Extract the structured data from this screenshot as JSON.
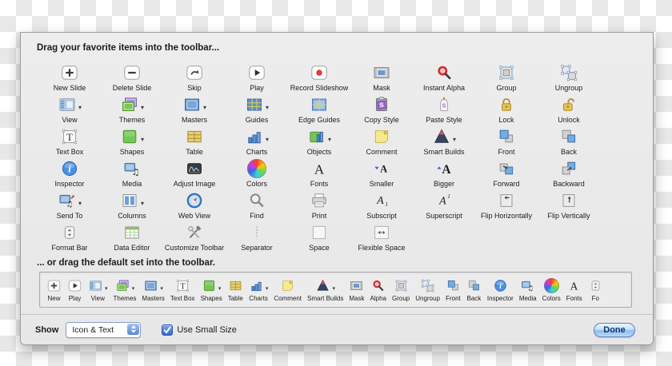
{
  "sheet": {
    "drag_text": "Drag your favorite items into the toolbar...",
    "default_text": "... or drag the default set into the toolbar.",
    "palette": [
      {
        "label": "New Slide",
        "icon": "new-slide",
        "arrow": false
      },
      {
        "label": "Delete Slide",
        "icon": "delete-slide",
        "arrow": false
      },
      {
        "label": "Skip",
        "icon": "skip",
        "arrow": false
      },
      {
        "label": "Play",
        "icon": "play",
        "arrow": false
      },
      {
        "label": "Record Slideshow",
        "icon": "record-slideshow",
        "arrow": false
      },
      {
        "label": "Mask",
        "icon": "mask",
        "arrow": false
      },
      {
        "label": "Instant Alpha",
        "icon": "instant-alpha",
        "arrow": false
      },
      {
        "label": "Group",
        "icon": "group",
        "arrow": false
      },
      {
        "label": "Ungroup",
        "icon": "ungroup",
        "arrow": false
      },
      {
        "label": "View",
        "icon": "view",
        "arrow": true
      },
      {
        "label": "Themes",
        "icon": "themes",
        "arrow": true
      },
      {
        "label": "Masters",
        "icon": "masters",
        "arrow": true
      },
      {
        "label": "Guides",
        "icon": "guides",
        "arrow": true
      },
      {
        "label": "Edge Guides",
        "icon": "edge-guides",
        "arrow": false
      },
      {
        "label": "Copy Style",
        "icon": "copy-style",
        "arrow": false
      },
      {
        "label": "Paste Style",
        "icon": "paste-style",
        "arrow": false
      },
      {
        "label": "Lock",
        "icon": "lock",
        "arrow": false
      },
      {
        "label": "Unlock",
        "icon": "unlock",
        "arrow": false
      },
      {
        "label": "Text Box",
        "icon": "text-box",
        "arrow": false
      },
      {
        "label": "Shapes",
        "icon": "shapes",
        "arrow": true
      },
      {
        "label": "Table",
        "icon": "table",
        "arrow": false
      },
      {
        "label": "Charts",
        "icon": "charts",
        "arrow": true
      },
      {
        "label": "Objects",
        "icon": "objects",
        "arrow": true
      },
      {
        "label": "Comment",
        "icon": "comment",
        "arrow": false
      },
      {
        "label": "Smart Builds",
        "icon": "smart-builds",
        "arrow": true
      },
      {
        "label": "Front",
        "icon": "front",
        "arrow": false
      },
      {
        "label": "Back",
        "icon": "back",
        "arrow": false
      },
      {
        "label": "Inspector",
        "icon": "inspector",
        "arrow": false
      },
      {
        "label": "Media",
        "icon": "media",
        "arrow": false
      },
      {
        "label": "Adjust Image",
        "icon": "adjust-image",
        "arrow": false
      },
      {
        "label": "Colors",
        "icon": "colors",
        "arrow": false
      },
      {
        "label": "Fonts",
        "icon": "fonts",
        "arrow": false
      },
      {
        "label": "Smaller",
        "icon": "smaller",
        "arrow": false
      },
      {
        "label": "Bigger",
        "icon": "bigger",
        "arrow": false
      },
      {
        "label": "Forward",
        "icon": "forward",
        "arrow": false
      },
      {
        "label": "Backward",
        "icon": "backward",
        "arrow": false
      },
      {
        "label": "Send To",
        "icon": "send-to",
        "arrow": true
      },
      {
        "label": "Columns",
        "icon": "columns",
        "arrow": true
      },
      {
        "label": "Web View",
        "icon": "web-view",
        "arrow": false
      },
      {
        "label": "Find",
        "icon": "find",
        "arrow": false
      },
      {
        "label": "Print",
        "icon": "print",
        "arrow": false
      },
      {
        "label": "Subscript",
        "icon": "subscript",
        "arrow": false
      },
      {
        "label": "Superscript",
        "icon": "superscript",
        "arrow": false
      },
      {
        "label": "Flip Horizontally",
        "icon": "flip-horizontally",
        "arrow": false
      },
      {
        "label": "Flip Vertically",
        "icon": "flip-vertically",
        "arrow": false
      },
      {
        "label": "Format Bar",
        "icon": "format-bar",
        "arrow": false
      },
      {
        "label": "Data Editor",
        "icon": "data-editor",
        "arrow": false
      },
      {
        "label": "Customize Toolbar",
        "icon": "customize-toolbar",
        "arrow": false
      },
      {
        "label": "Separator",
        "icon": "separator",
        "arrow": false
      },
      {
        "label": "Space",
        "icon": "space",
        "arrow": false
      },
      {
        "label": "Flexible Space",
        "icon": "flexible-space",
        "arrow": false
      }
    ],
    "default_set": [
      {
        "label": "New",
        "icon": "new-slide",
        "arrow": false
      },
      {
        "label": "Play",
        "icon": "play",
        "arrow": false
      },
      {
        "label": "View",
        "icon": "view",
        "arrow": true
      },
      {
        "label": "Themes",
        "icon": "themes",
        "arrow": true
      },
      {
        "label": "Masters",
        "icon": "masters",
        "arrow": true
      },
      {
        "label": "Text Box",
        "icon": "text-box",
        "arrow": false
      },
      {
        "label": "Shapes",
        "icon": "shapes",
        "arrow": true
      },
      {
        "label": "Table",
        "icon": "table",
        "arrow": false
      },
      {
        "label": "Charts",
        "icon": "charts",
        "arrow": true
      },
      {
        "label": "Comment",
        "icon": "comment",
        "arrow": false
      },
      {
        "label": "Smart Builds",
        "icon": "smart-builds",
        "arrow": true
      },
      {
        "label": "Mask",
        "icon": "mask",
        "arrow": false
      },
      {
        "label": "Alpha",
        "icon": "instant-alpha",
        "arrow": false
      },
      {
        "label": "Group",
        "icon": "group",
        "arrow": false
      },
      {
        "label": "Ungroup",
        "icon": "ungroup",
        "arrow": false
      },
      {
        "label": "Front",
        "icon": "front",
        "arrow": false
      },
      {
        "label": "Back",
        "icon": "back",
        "arrow": false
      },
      {
        "label": "Inspector",
        "icon": "inspector",
        "arrow": false
      },
      {
        "label": "Media",
        "icon": "media",
        "arrow": false
      },
      {
        "label": "Colors",
        "icon": "colors",
        "arrow": false
      },
      {
        "label": "Fonts",
        "icon": "fonts",
        "arrow": false
      },
      {
        "label": "Fo",
        "icon": "format-bar",
        "arrow": false,
        "clipped": true
      }
    ],
    "footer": {
      "show_label": "Show",
      "show_value": "Icon & Text",
      "small_size_label": "Use Small Size",
      "small_size_checked": true,
      "done_label": "Done"
    },
    "colors": {
      "accent_blue": "#3b76d7",
      "sheet_bg": "#e9e9e9",
      "label_text": "#1d1d1d",
      "record_red": "#e23b30",
      "lock_yellow": "#e7c24c"
    }
  }
}
